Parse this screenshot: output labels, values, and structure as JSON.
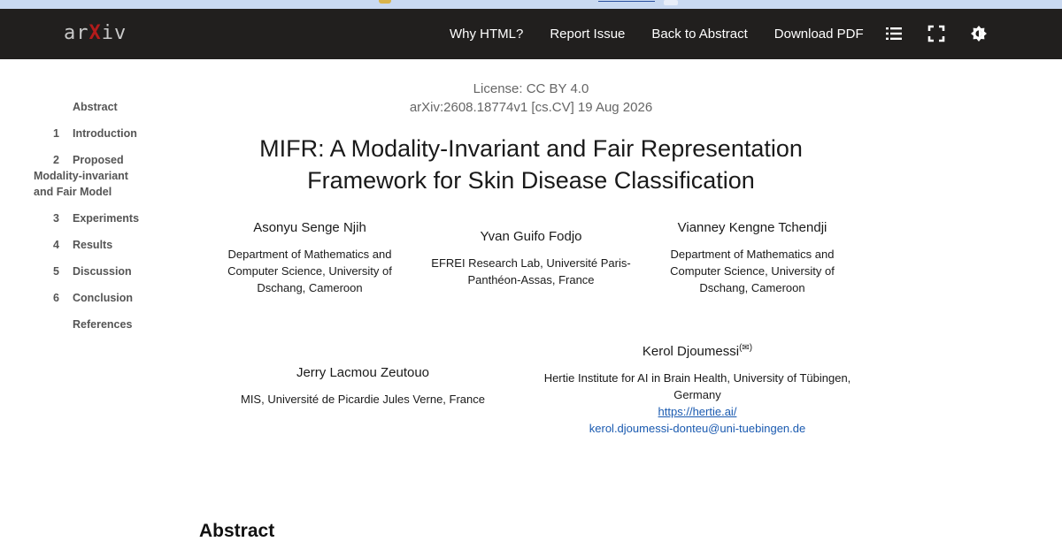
{
  "header": {
    "logo_text_a": "ar",
    "logo_text_x": "X",
    "logo_text_b": "iv",
    "nav": [
      {
        "label": "Why HTML?"
      },
      {
        "label": "Report Issue"
      },
      {
        "label": "Back to Abstract"
      },
      {
        "label": "Download PDF"
      }
    ],
    "icons": [
      "list-icon",
      "fullscreen-icon",
      "theme-icon"
    ]
  },
  "toc": [
    {
      "num": "",
      "label": "Abstract"
    },
    {
      "num": "1",
      "label": "Introduction"
    },
    {
      "num": "2",
      "label": "Proposed",
      "cont": "Modality-invariant and Fair Model"
    },
    {
      "num": "3",
      "label": "Experiments"
    },
    {
      "num": "4",
      "label": "Results"
    },
    {
      "num": "5",
      "label": "Discussion"
    },
    {
      "num": "6",
      "label": "Conclusion"
    },
    {
      "num": "",
      "label": "References"
    }
  ],
  "paper": {
    "license": "License: CC BY 4.0",
    "arxiv_id": "arXiv:2608.18774v1 [cs.CV] 19 Aug 2026",
    "title": "MIFR: A Modality-Invariant and Fair Representation Framework for Skin Disease Classification",
    "authors": [
      {
        "name": "Asonyu Senge Njih",
        "affiliation": "Department of Mathematics and Computer Science, University of Dschang, Cameroon"
      },
      {
        "name": "Yvan Guifo Fodjo",
        "affiliation": "EFREI Research Lab, Université Paris-Panthéon-Assas, France"
      },
      {
        "name": "Vianney Kengne Tchendji",
        "affiliation": "Department of Mathematics and Computer Science, University of Dschang, Cameroon"
      },
      {
        "name": "Jerry Lacmou Zeutouo",
        "affiliation": "MIS, Université de Picardie Jules Verne, France"
      },
      {
        "name": "Kerol Djoumessi",
        "corresponding_mark": "(✉)",
        "affiliation": "Hertie Institute for AI in Brain Health, University of Tübingen, Germany",
        "url": "https://hertie.ai/",
        "email": "kerol.djoumessi-donteu@uni-tuebingen.de"
      }
    ],
    "abstract_heading": "Abstract"
  }
}
